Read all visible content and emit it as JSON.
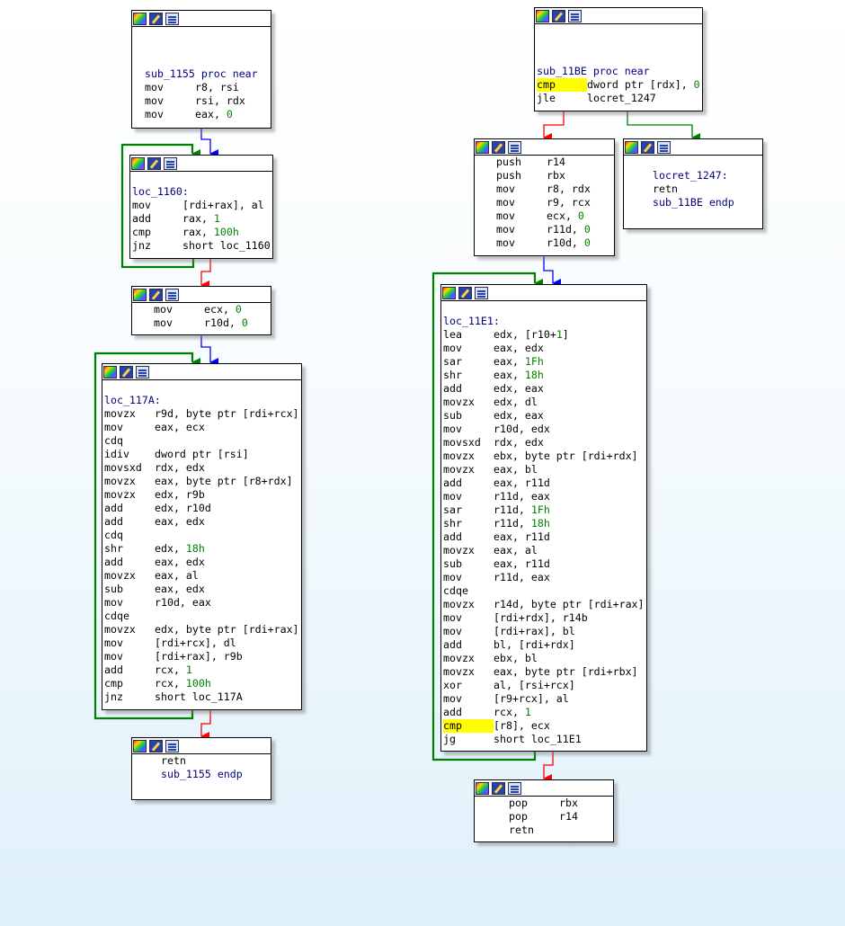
{
  "colors": {
    "true_edge": "#008000",
    "false_edge": "#ff0000",
    "flow_edge": "#0000ff",
    "number": "#008000",
    "highlight": "#ffff00"
  },
  "icons": [
    "color-palette-icon",
    "edit-icon",
    "graph-icon"
  ],
  "nodes": [
    {
      "name": "node-sub-1155-entry",
      "lines": [
        {
          "text": ""
        },
        {
          "text": ""
        },
        {
          "text": ""
        },
        {
          "label": "sub_1155 proc near"
        },
        {
          "mn": "mov",
          "ops": "r8, rsi"
        },
        {
          "mn": "mov",
          "ops": "rsi, rdx"
        },
        {
          "mn": "mov",
          "ops": "eax, ",
          "num": "0"
        }
      ]
    },
    {
      "name": "node-loc-1160",
      "lines": [
        {
          "text": ""
        },
        {
          "label": "loc_1160:"
        },
        {
          "mn": "mov",
          "ops": "[rdi+rax], al"
        },
        {
          "mn": "add",
          "ops": "rax, ",
          "num": "1"
        },
        {
          "mn": "cmp",
          "ops": "rax, ",
          "num": "100h"
        },
        {
          "mn": "jnz",
          "ops": "short loc_1160"
        }
      ]
    },
    {
      "name": "node-init-ecx",
      "lines": [
        {
          "mn": "mov",
          "ops": "ecx, ",
          "num": "0"
        },
        {
          "mn": "mov",
          "ops": "r10d, ",
          "num": "0"
        }
      ]
    },
    {
      "name": "node-loc-117a",
      "lines": [
        {
          "text": ""
        },
        {
          "label": "loc_117A:"
        },
        {
          "mn": "movzx",
          "ops": "r9d, byte ptr [rdi+rcx]"
        },
        {
          "mn": "mov",
          "ops": "eax, ecx"
        },
        {
          "mn": "cdq",
          "ops": ""
        },
        {
          "mn": "idiv",
          "ops": "dword ptr [rsi]"
        },
        {
          "mn": "movsxd",
          "ops": "rdx, edx"
        },
        {
          "mn": "movzx",
          "ops": "eax, byte ptr [r8+rdx]"
        },
        {
          "mn": "movzx",
          "ops": "edx, r9b"
        },
        {
          "mn": "add",
          "ops": "edx, r10d"
        },
        {
          "mn": "add",
          "ops": "eax, edx"
        },
        {
          "mn": "cdq",
          "ops": ""
        },
        {
          "mn": "shr",
          "ops": "edx, ",
          "num": "18h"
        },
        {
          "mn": "add",
          "ops": "eax, edx"
        },
        {
          "mn": "movzx",
          "ops": "eax, al"
        },
        {
          "mn": "sub",
          "ops": "eax, edx"
        },
        {
          "mn": "mov",
          "ops": "r10d, eax"
        },
        {
          "mn": "cdqe",
          "ops": ""
        },
        {
          "mn": "movzx",
          "ops": "edx, byte ptr [rdi+rax]"
        },
        {
          "mn": "mov",
          "ops": "[rdi+rcx], dl"
        },
        {
          "mn": "mov",
          "ops": "[rdi+rax], r9b"
        },
        {
          "mn": "add",
          "ops": "rcx, ",
          "num": "1"
        },
        {
          "mn": "cmp",
          "ops": "rcx, ",
          "num": "100h"
        },
        {
          "mn": "jnz",
          "ops": "short loc_117A"
        }
      ]
    },
    {
      "name": "node-sub-1155-ret",
      "lines": [
        {
          "mn": "retn",
          "ops": ""
        },
        {
          "label": "sub_1155 endp"
        }
      ]
    },
    {
      "name": "node-sub-11be-entry",
      "lines": [
        {
          "text": ""
        },
        {
          "text": ""
        },
        {
          "text": ""
        },
        {
          "label": "sub_11BE proc near"
        },
        {
          "mn": "cmp",
          "ops": "dword ptr [rdx], ",
          "num": "0",
          "hl": true
        },
        {
          "mn": "jle",
          "ops": "locret_1247"
        }
      ]
    },
    {
      "name": "node-push-block",
      "lines": [
        {
          "mn": "push",
          "ops": "r14"
        },
        {
          "mn": "push",
          "ops": "rbx"
        },
        {
          "mn": "mov",
          "ops": "r8, rdx"
        },
        {
          "mn": "mov",
          "ops": "r9, rcx"
        },
        {
          "mn": "mov",
          "ops": "ecx, ",
          "num": "0"
        },
        {
          "mn": "mov",
          "ops": "r11d, ",
          "num": "0"
        },
        {
          "mn": "mov",
          "ops": "r10d, ",
          "num": "0"
        }
      ]
    },
    {
      "name": "node-locret-1247",
      "lines": [
        {
          "text": ""
        },
        {
          "label": "locret_1247:"
        },
        {
          "mn": "retn",
          "ops": ""
        },
        {
          "label": "sub_11BE endp"
        }
      ]
    },
    {
      "name": "node-loc-11e1",
      "lines": [
        {
          "text": ""
        },
        {
          "label": "loc_11E1:"
        },
        {
          "mn": "lea",
          "ops": "edx, [r10+",
          "num": "1",
          "tail": "]"
        },
        {
          "mn": "mov",
          "ops": "eax, edx"
        },
        {
          "mn": "sar",
          "ops": "eax, ",
          "num": "1Fh"
        },
        {
          "mn": "shr",
          "ops": "eax, ",
          "num": "18h"
        },
        {
          "mn": "add",
          "ops": "edx, eax"
        },
        {
          "mn": "movzx",
          "ops": "edx, dl"
        },
        {
          "mn": "sub",
          "ops": "edx, eax"
        },
        {
          "mn": "mov",
          "ops": "r10d, edx"
        },
        {
          "mn": "movsxd",
          "ops": "rdx, edx"
        },
        {
          "mn": "movzx",
          "ops": "ebx, byte ptr [rdi+rdx]"
        },
        {
          "mn": "movzx",
          "ops": "eax, bl"
        },
        {
          "mn": "add",
          "ops": "eax, r11d"
        },
        {
          "mn": "mov",
          "ops": "r11d, eax"
        },
        {
          "mn": "sar",
          "ops": "r11d, ",
          "num": "1Fh"
        },
        {
          "mn": "shr",
          "ops": "r11d, ",
          "num": "18h"
        },
        {
          "mn": "add",
          "ops": "eax, r11d"
        },
        {
          "mn": "movzx",
          "ops": "eax, al"
        },
        {
          "mn": "sub",
          "ops": "eax, r11d"
        },
        {
          "mn": "mov",
          "ops": "r11d, eax"
        },
        {
          "mn": "cdqe",
          "ops": ""
        },
        {
          "mn": "movzx",
          "ops": "r14d, byte ptr [rdi+rax]"
        },
        {
          "mn": "mov",
          "ops": "[rdi+rdx], r14b"
        },
        {
          "mn": "mov",
          "ops": "[rdi+rax], bl"
        },
        {
          "mn": "add",
          "ops": "bl, [rdi+rdx]"
        },
        {
          "mn": "movzx",
          "ops": "ebx, bl"
        },
        {
          "mn": "movzx",
          "ops": "eax, byte ptr [rdi+rbx]"
        },
        {
          "mn": "xor",
          "ops": "al, [rsi+rcx]"
        },
        {
          "mn": "mov",
          "ops": "[r9+rcx], al"
        },
        {
          "mn": "add",
          "ops": "rcx, ",
          "num": "1"
        },
        {
          "mn": "cmp",
          "ops": "[r8], ecx",
          "hl": true
        },
        {
          "mn": "jg",
          "ops": "short loc_11E1"
        }
      ]
    },
    {
      "name": "node-pop-block",
      "lines": [
        {
          "mn": "pop",
          "ops": "rbx"
        },
        {
          "mn": "pop",
          "ops": "r14"
        },
        {
          "mn": "retn",
          "ops": ""
        }
      ]
    }
  ]
}
